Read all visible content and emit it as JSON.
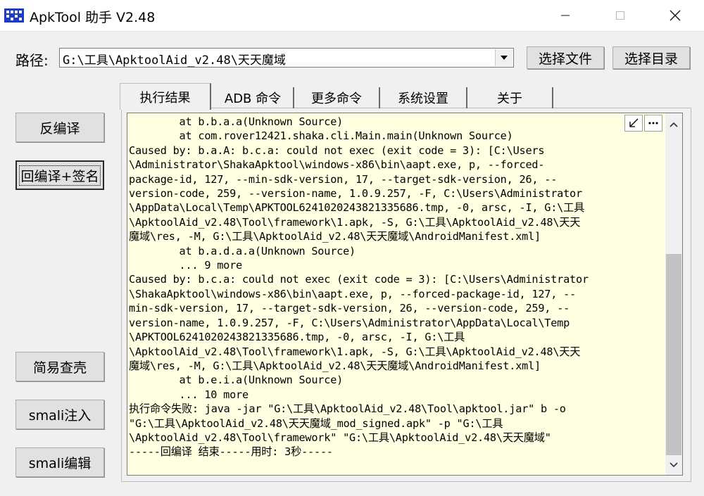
{
  "window": {
    "title": "ApkTool 助手 V2.48",
    "icons": {
      "app": "app-icon",
      "minimize": "minimize-icon",
      "maximize": "maximize-icon",
      "close": "close-icon"
    }
  },
  "path": {
    "label": "路径:",
    "value": "G:\\工具\\ApktoolAid_v2.48\\天天魔域",
    "select_file": "选择文件",
    "select_dir": "选择目录"
  },
  "side_buttons": {
    "decompile": "反编译",
    "recompile_sign": "回编译+签名",
    "shell_check": "简易查壳",
    "smali_inject": "smali注入",
    "smali_edit": "smali编辑"
  },
  "tabs": [
    "执行结果",
    "ADB 命令",
    "更多命令",
    "系统设置",
    "关于"
  ],
  "active_tab": 0,
  "log": [
    "        at b.b.a.a(Unknown Source)",
    "        at com.rover12421.shaka.cli.Main.main(Unknown Source)",
    "Caused by: b.a.A: b.c.a: could not exec (exit code = 3): [C:\\Users",
    "\\Administrator\\ShakaApktool\\windows-x86\\bin\\aapt.exe, p, --forced-",
    "package-id, 127, --min-sdk-version, 17, --target-sdk-version, 26, --",
    "version-code, 259, --version-name, 1.0.9.257, -F, C:\\Users\\Administrator",
    "\\AppData\\Local\\Temp\\APKTOOL6241020243821335686.tmp, -0, arsc, -I, G:\\工具",
    "\\ApktoolAid_v2.48\\Tool\\framework\\1.apk, -S, G:\\工具\\ApktoolAid_v2.48\\天天",
    "魔域\\res, -M, G:\\工具\\ApktoolAid_v2.48\\天天魔域\\AndroidManifest.xml]",
    "        at b.a.d.a.a(Unknown Source)",
    "        ... 9 more",
    "Caused by: b.c.a: could not exec (exit code = 3): [C:\\Users\\Administrator",
    "\\ShakaApktool\\windows-x86\\bin\\aapt.exe, p, --forced-package-id, 127, --",
    "min-sdk-version, 17, --target-sdk-version, 26, --version-code, 259, --",
    "version-name, 1.0.9.257, -F, C:\\Users\\Administrator\\AppData\\Local\\Temp",
    "\\APKTOOL6241020243821335686.tmp, -0, arsc, -I, G:\\工具",
    "\\ApktoolAid_v2.48\\Tool\\framework\\1.apk, -S, G:\\工具\\ApktoolAid_v2.48\\天天",
    "魔域\\res, -M, G:\\工具\\ApktoolAid_v2.48\\天天魔域\\AndroidManifest.xml]",
    "        at b.e.i.a(Unknown Source)",
    "        ... 10 more",
    "执行命令失败: java -jar \"G:\\工具\\ApktoolAid_v2.48\\Tool\\apktool.jar\" b -o",
    "\"G:\\工具\\ApktoolAid_v2.48\\天天魔域_mod_signed.apk\" -p \"G:\\工具",
    "\\ApktoolAid_v2.48\\Tool\\framework\" \"G:\\工具\\ApktoolAid_v2.48\\天天魔域\"",
    "-----回编译 结束-----用时: 3秒-----"
  ]
}
